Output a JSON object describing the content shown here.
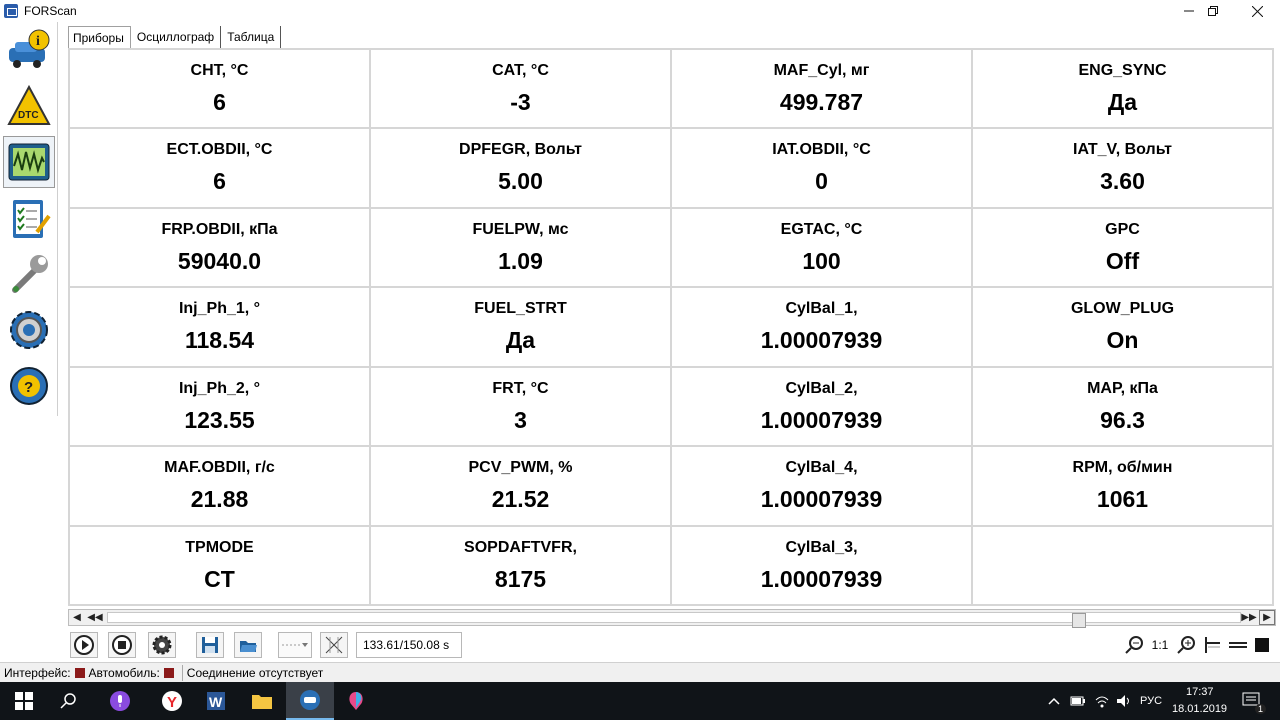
{
  "window": {
    "title": "FORScan"
  },
  "tabs": [
    "Приборы",
    "Осциллограф",
    "Таблица"
  ],
  "gauges": [
    {
      "name": "CHT, °C",
      "value": "6"
    },
    {
      "name": "CAT, °C",
      "value": "-3"
    },
    {
      "name": "MAF_Cyl, мг",
      "value": "499.787"
    },
    {
      "name": "ENG_SYNC",
      "value": "Да"
    },
    {
      "name": "ECT.OBDII, °C",
      "value": "6"
    },
    {
      "name": "DPFEGR, Вольт",
      "value": "5.00"
    },
    {
      "name": "IAT.OBDII, °C",
      "value": "0"
    },
    {
      "name": "IAT_V, Вольт",
      "value": "3.60"
    },
    {
      "name": "FRP.OBDII, кПа",
      "value": "59040.0"
    },
    {
      "name": "FUELPW, мс",
      "value": "1.09"
    },
    {
      "name": "EGTAC, °C",
      "value": "100"
    },
    {
      "name": "GPC",
      "value": "Off"
    },
    {
      "name": "Inj_Ph_1, °",
      "value": "118.54"
    },
    {
      "name": "FUEL_STRT",
      "value": "Да"
    },
    {
      "name": "CylBal_1,",
      "value": "1.00007939"
    },
    {
      "name": "GLOW_PLUG",
      "value": "On"
    },
    {
      "name": "Inj_Ph_2, °",
      "value": "123.55"
    },
    {
      "name": "FRT, °C",
      "value": "3"
    },
    {
      "name": "CylBal_2,",
      "value": "1.00007939"
    },
    {
      "name": "MAP, кПа",
      "value": "96.3"
    },
    {
      "name": "MAF.OBDII, г/с",
      "value": "21.88"
    },
    {
      "name": "PCV_PWM, %",
      "value": "21.52"
    },
    {
      "name": "CylBal_4,",
      "value": "1.00007939"
    },
    {
      "name": "RPM, об/мин",
      "value": "1061"
    },
    {
      "name": "TPMODE",
      "value": "CT"
    },
    {
      "name": "SOPDAFTVFR,",
      "value": "8175"
    },
    {
      "name": "CylBal_3,",
      "value": "1.00007939"
    },
    {
      "name": "",
      "value": ""
    }
  ],
  "toolbar": {
    "time_readout": "133.61/150.08 s",
    "zoom_label": "1:1"
  },
  "status": {
    "interface_label": "Интерфейс:",
    "vehicle_label": "Автомобиль:",
    "connection_text": "Соединение отсутствует"
  },
  "taskbar": {
    "lang": "РУС",
    "time": "17:37",
    "date": "18.01.2019",
    "notifications": "1"
  },
  "colors": {
    "status_red": "#8b1a1a",
    "taskbar_bg": "#101418"
  }
}
